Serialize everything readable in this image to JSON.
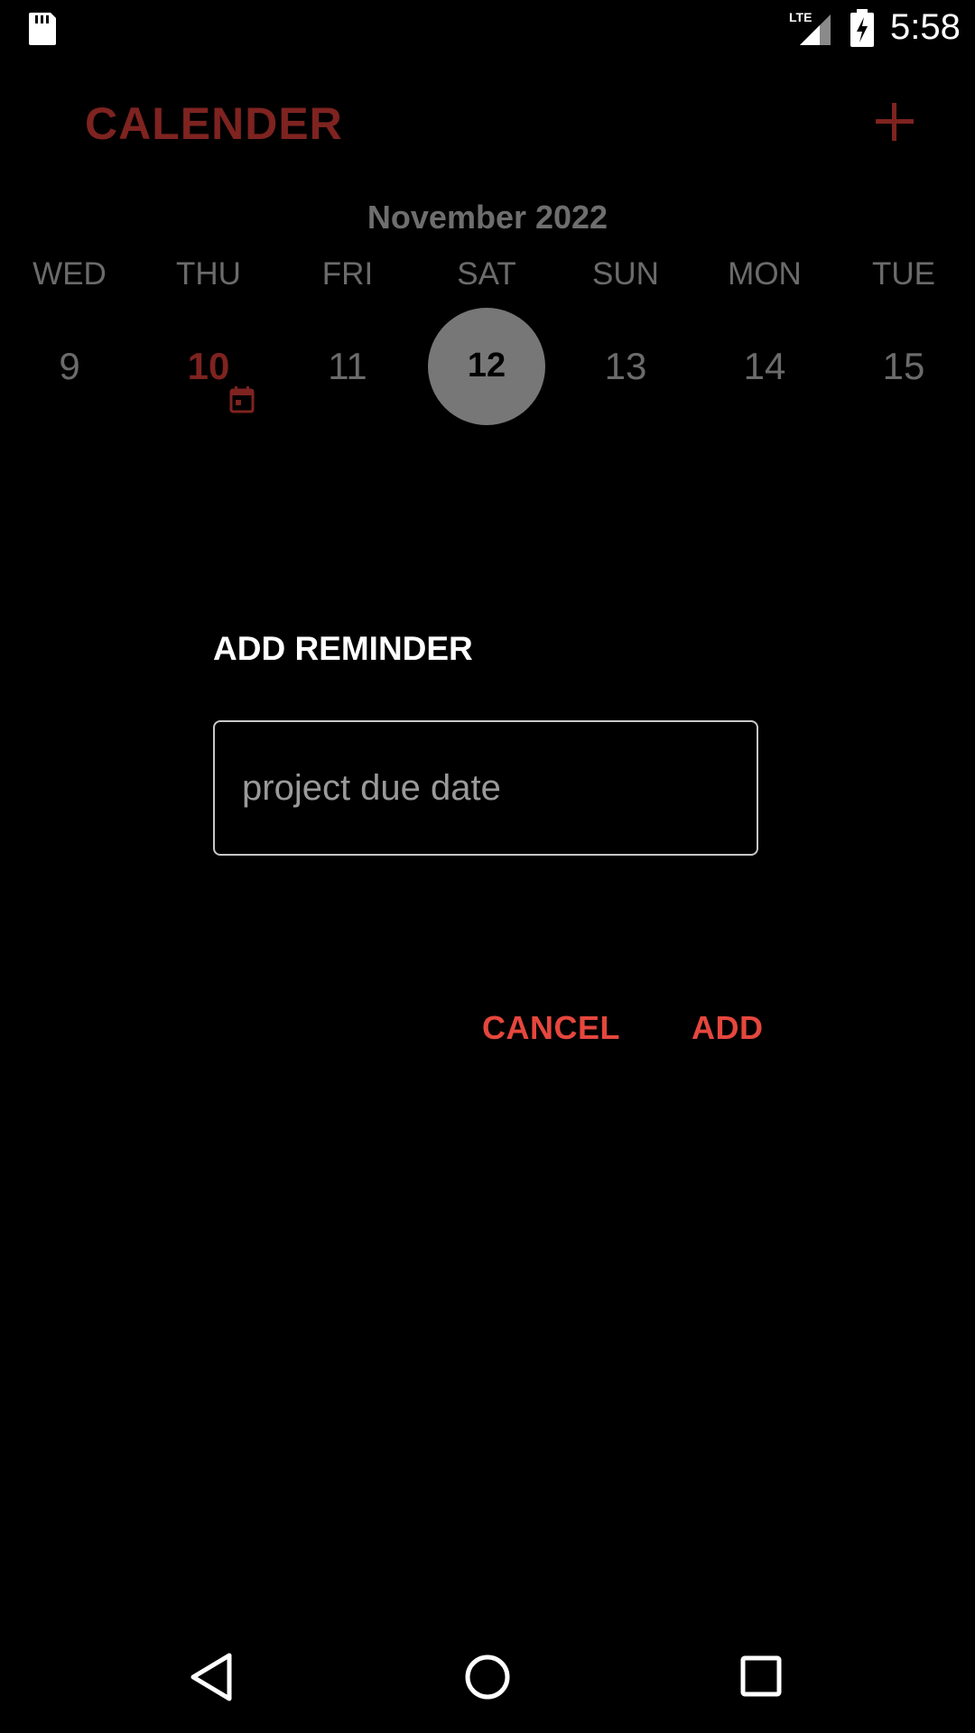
{
  "status_bar": {
    "time": "5:58",
    "network_label": "LTE",
    "icons": [
      "sd-card-icon",
      "lte-signal-icon",
      "battery-charging-icon"
    ]
  },
  "header": {
    "title": "CALENDER",
    "add_icon": "plus-icon"
  },
  "calendar": {
    "month": "November 2022",
    "weekdays": [
      "WED",
      "THU",
      "FRI",
      "SAT",
      "SUN",
      "MON",
      "TUE"
    ],
    "dates": [
      "9",
      "10",
      "11",
      "12",
      "13",
      "14",
      "15"
    ],
    "today": "10",
    "selected": "12",
    "event_dates": [
      "10"
    ]
  },
  "dialog": {
    "title": "ADD REMINDER",
    "input_value": "",
    "input_placeholder": "project due date",
    "cancel_label": "CANCEL",
    "add_label": "ADD"
  },
  "nav_bar": {
    "icons": [
      "back-icon",
      "home-icon",
      "recents-icon"
    ]
  },
  "colors": {
    "background": "#000000",
    "accent_dark": "#7e2320",
    "accent_button": "#e5473d",
    "muted_text": "#6b6b6b",
    "selected_circle": "#777777"
  }
}
